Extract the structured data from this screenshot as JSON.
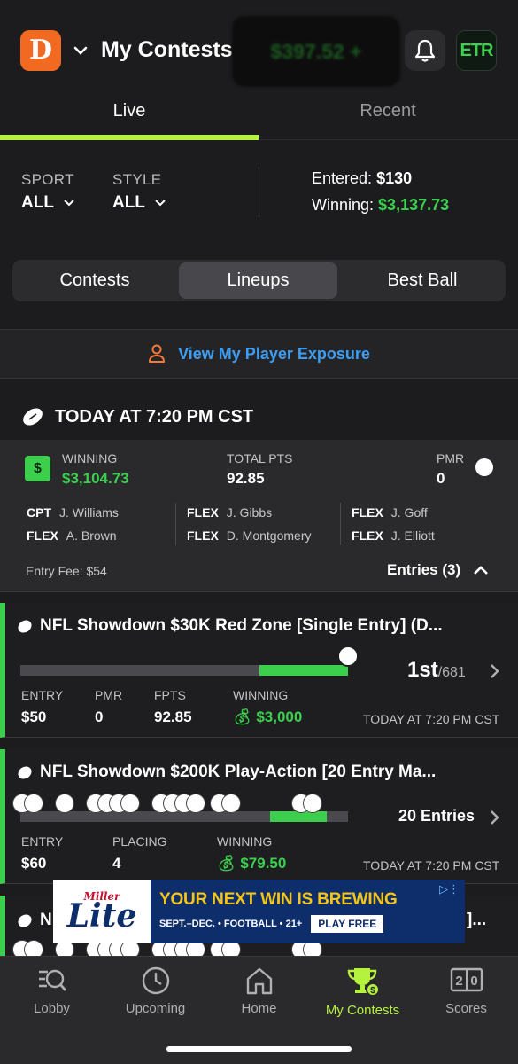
{
  "header": {
    "title": "My Contests",
    "balance": "$397.52 +",
    "avatar_text": "ETR"
  },
  "tabs": [
    {
      "label": "Live",
      "active": true
    },
    {
      "label": "Recent",
      "active": false
    }
  ],
  "filters": {
    "sport_label": "SPORT",
    "sport_value": "ALL",
    "style_label": "STYLE",
    "style_value": "ALL"
  },
  "stats": {
    "entered_label": "Entered:",
    "entered_value": "$130",
    "winning_label": "Winning:",
    "winning_value": "$3,137.73"
  },
  "segments": [
    {
      "label": "Contests",
      "active": false
    },
    {
      "label": "Lineups",
      "active": true
    },
    {
      "label": "Best Ball",
      "active": false
    }
  ],
  "exposure_link": "View My Player Exposure",
  "slate": {
    "time": "TODAY AT 7:20 PM CST",
    "winning_label": "WINNING",
    "winning_value": "$3,104.73",
    "total_pts_label": "TOTAL PTS",
    "total_pts_value": "92.85",
    "pmr_label": "PMR",
    "pmr_value": "0",
    "lineup": [
      {
        "pos": "CPT",
        "name": "J. Williams"
      },
      {
        "pos": "FLEX",
        "name": "A. Brown"
      },
      {
        "pos": "FLEX",
        "name": "J. Gibbs"
      },
      {
        "pos": "FLEX",
        "name": "D. Montgomery"
      },
      {
        "pos": "FLEX",
        "name": "J. Goff"
      },
      {
        "pos": "FLEX",
        "name": "J. Elliott"
      }
    ],
    "entry_fee": "Entry Fee: $54",
    "entries_toggle": "Entries (3)"
  },
  "contests": [
    {
      "title": "NFL Showdown $30K Red Zone [Single Entry] (D...",
      "progress": 0.27,
      "rank": "1st",
      "rank_of": "/681",
      "col1_label": "ENTRY",
      "col1_value": "$50",
      "col2_label": "PMR",
      "col2_value": "0",
      "col3_label": "FPTS",
      "col3_value": "92.85",
      "col4_label": "WINNING",
      "col4_value": "$3,000",
      "time": "TODAY AT 7:20 PM CST"
    },
    {
      "title": "NFL Showdown $200K Play-Action [20 Entry Ma...",
      "progress": 0.24,
      "rank": "20 Entries",
      "col1_label": "ENTRY",
      "col1_value": "$60",
      "col2_label": "PLACING",
      "col2_value": "4",
      "col3_label": "WINNING",
      "col3_value": "$79.50",
      "time": "TODAY AT 7:20 PM CST"
    },
    {
      "title": "N",
      "title_tail": "]..."
    }
  ],
  "ad": {
    "brand": "Miller",
    "logo": "Lite",
    "headline": "YOUR NEXT WIN IS BREWING",
    "sub": "SEPT.–DEC. • FOOTBALL • 21+",
    "cta": "PLAY FREE"
  },
  "nav": [
    {
      "label": "Lobby",
      "icon": "lobby-search-icon"
    },
    {
      "label": "Upcoming",
      "icon": "clock-icon"
    },
    {
      "label": "Home",
      "icon": "home-icon"
    },
    {
      "label": "My Contests",
      "icon": "trophy-icon",
      "active": true
    },
    {
      "label": "Scores",
      "icon": "scoreboard-icon"
    }
  ],
  "colors": {
    "accent": "#b5f23d",
    "winning_green": "#3ccf4e",
    "link_blue": "#3d9df2",
    "brand_orange": "#f26a21"
  }
}
